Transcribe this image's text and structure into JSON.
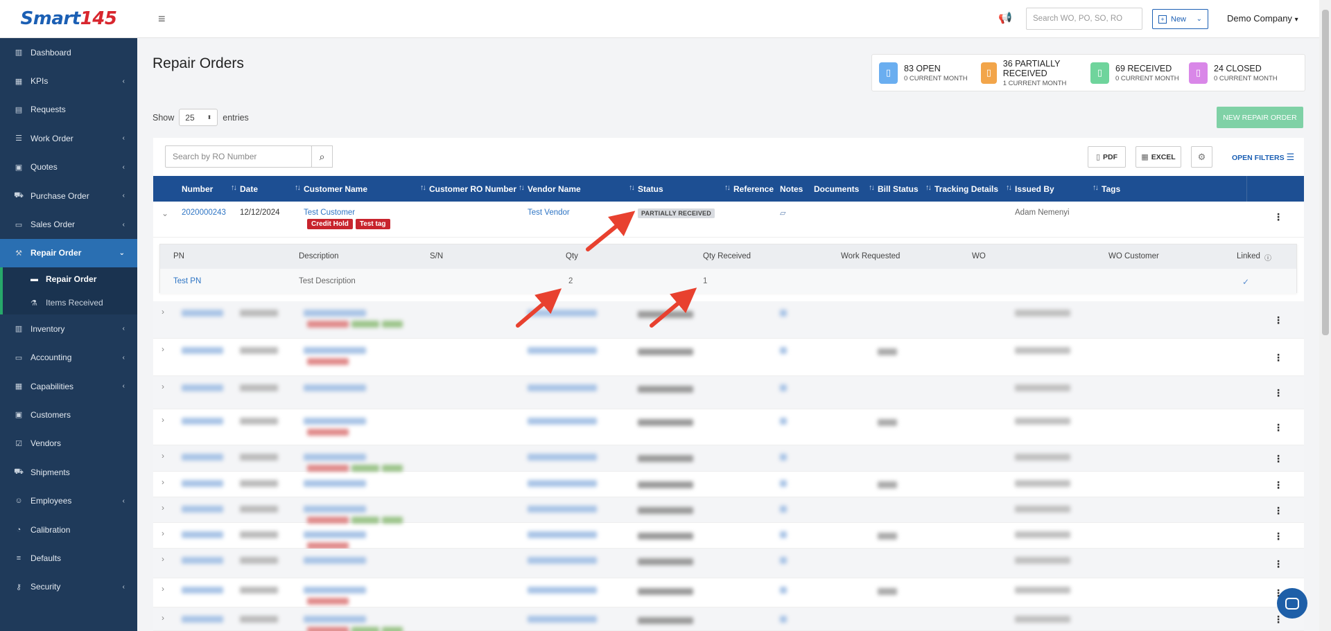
{
  "logo": {
    "part1": "Smart",
    "part2": "145"
  },
  "sidebar": {
    "items": [
      {
        "label": "Dashboard",
        "icon": "chart-icon",
        "glyph": "▥",
        "chevron": false
      },
      {
        "label": "KPIs",
        "icon": "bar-chart-icon",
        "glyph": "▦",
        "chevron": true
      },
      {
        "label": "Requests",
        "icon": "document-icon",
        "glyph": "▤",
        "chevron": false
      },
      {
        "label": "Work Order",
        "icon": "list-icon",
        "glyph": "☰",
        "chevron": true
      },
      {
        "label": "Quotes",
        "icon": "clipboard-icon",
        "glyph": "▣",
        "chevron": true
      },
      {
        "label": "Purchase Order",
        "icon": "cart-icon",
        "glyph": "⛟",
        "chevron": true
      },
      {
        "label": "Sales Order",
        "icon": "register-icon",
        "glyph": "▭",
        "chevron": true
      },
      {
        "label": "Repair Order",
        "icon": "toolbox-icon",
        "glyph": "⚒",
        "chevron": true,
        "active": true
      }
    ],
    "subitems": [
      {
        "label": "Repair Order",
        "icon": "list-icon",
        "glyph": "▬",
        "active": true
      },
      {
        "label": "Items Received",
        "icon": "flask-icon",
        "glyph": "⚗",
        "active": false
      }
    ],
    "items_after": [
      {
        "label": "Inventory",
        "icon": "warehouse-icon",
        "glyph": "▥",
        "chevron": true
      },
      {
        "label": "Accounting",
        "icon": "money-icon",
        "glyph": "▭",
        "chevron": true
      },
      {
        "label": "Capabilities",
        "icon": "calendar-icon",
        "glyph": "▦",
        "chevron": true
      },
      {
        "label": "Customers",
        "icon": "briefcase-icon",
        "glyph": "▣",
        "chevron": false
      },
      {
        "label": "Vendors",
        "icon": "check-square-icon",
        "glyph": "☑",
        "chevron": false
      },
      {
        "label": "Shipments",
        "icon": "truck-icon",
        "glyph": "⛟",
        "chevron": false
      },
      {
        "label": "Employees",
        "icon": "users-icon",
        "glyph": "☺",
        "chevron": true
      },
      {
        "label": "Calibration",
        "icon": "gauge-icon",
        "glyph": "◔",
        "chevron": false
      },
      {
        "label": "Defaults",
        "icon": "sliders-icon",
        "glyph": "≡",
        "chevron": false
      },
      {
        "label": "Security",
        "icon": "key-icon",
        "glyph": "⚷",
        "chevron": true
      }
    ]
  },
  "topbar": {
    "search_placeholder": "Search WO, PO, SO, RO",
    "new_label": "New",
    "company": "Demo Company"
  },
  "page": {
    "title": "Repair Orders"
  },
  "stats": [
    {
      "title": "83 OPEN",
      "sub": "0 CURRENT MONTH",
      "color": "#6aaef0"
    },
    {
      "title": "36 PARTIALLY RECEIVED",
      "sub": "1 CURRENT MONTH",
      "color": "#f2a54a"
    },
    {
      "title": "69 RECEIVED",
      "sub": "0 CURRENT MONTH",
      "color": "#6fd49c"
    },
    {
      "title": "24 CLOSED",
      "sub": "0 CURRENT MONTH",
      "color": "#d987e8"
    }
  ],
  "show": {
    "prefix": "Show",
    "value": "25",
    "suffix": "entries"
  },
  "new_ro_label": "NEW REPAIR ORDER",
  "toolbar": {
    "search_placeholder": "Search by RO Number",
    "pdf": "PDF",
    "excel": "EXCEL",
    "open_filters": "OPEN FILTERS"
  },
  "columns": [
    "Number",
    "Date",
    "Customer Name",
    "Customer RO Number",
    "Vendor Name",
    "Status",
    "Reference",
    "Notes",
    "Documents",
    "Bill Status",
    "Tracking Details",
    "Issued By",
    "Tags"
  ],
  "first_row": {
    "number": "2020000243",
    "date": "12/12/2024",
    "customer": "Test Customer",
    "badges": [
      "Credit Hold",
      "Test tag"
    ],
    "vendor": "Test Vendor",
    "status": "PARTIALLY RECEIVED",
    "issued_by": "Adam Nemenyi"
  },
  "subtable": {
    "headers": [
      "PN",
      "Description",
      "S/N",
      "Qty",
      "Qty Received",
      "Work Requested",
      "WO",
      "WO Customer",
      "Linked"
    ],
    "row": {
      "pn": "Test PN",
      "description": "Test Description",
      "qty": "2",
      "qty_received": "1"
    }
  },
  "colors": {
    "sidebar": "#1f3a5a",
    "active": "#2a6fb2",
    "header": "#1d4f93",
    "link": "#2d74c4",
    "badge": "#c8242d",
    "arrow": "#e8412f"
  }
}
